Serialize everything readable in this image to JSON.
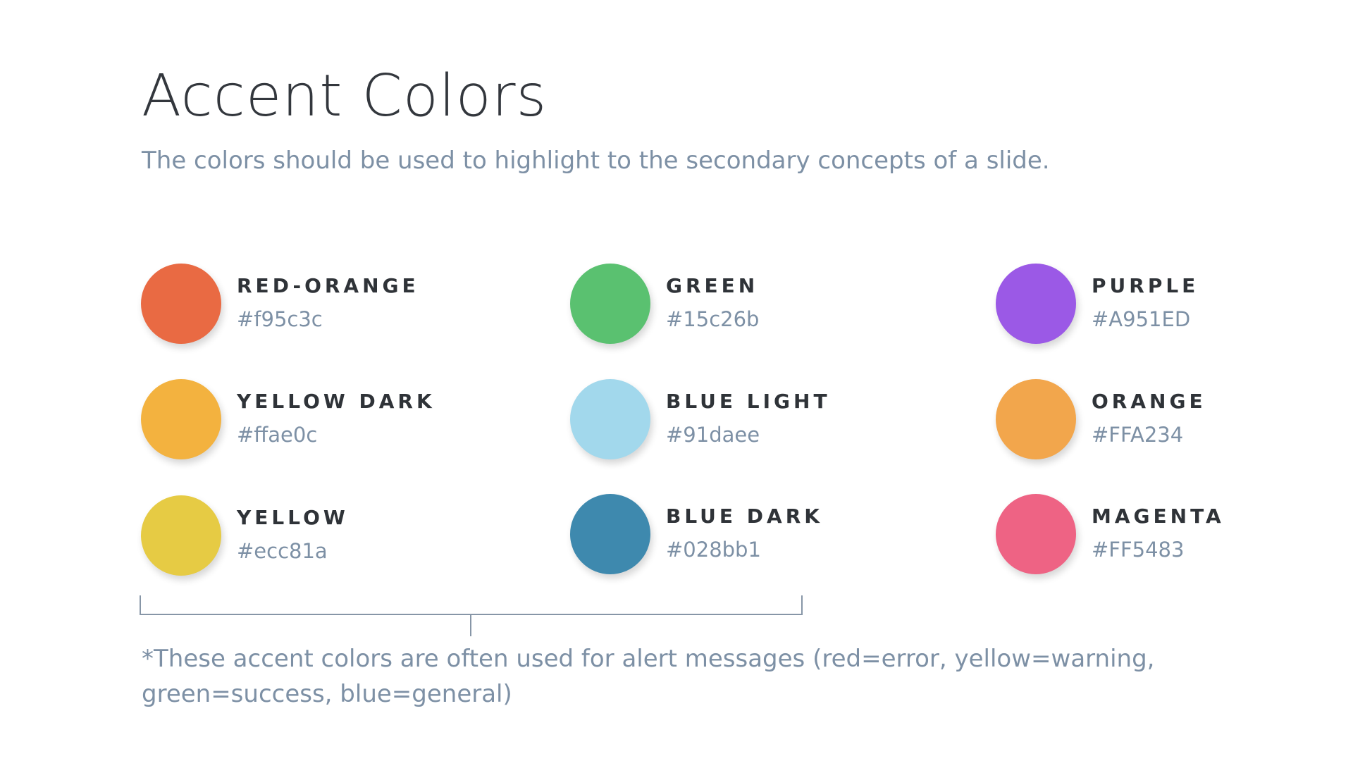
{
  "slide": {
    "title": "Accent Colors",
    "subtitle": "The colors should be used to highlight to the secondary concepts of a slide.",
    "footnote": "*These accent colors are often used for alert messages (red=error, yellow=warning, green=success, blue=general)"
  },
  "swatches": [
    {
      "name": "RED-ORANGE",
      "hex": "#f95c3c",
      "color": "#e96a43"
    },
    {
      "name": "YELLOW DARK",
      "hex": "#ffae0c",
      "color": "#f3b23f"
    },
    {
      "name": "YELLOW",
      "hex": "#ecc81a",
      "color": "#e6cb44"
    },
    {
      "name": "GREEN",
      "hex": "#15c26b",
      "color": "#5ac170"
    },
    {
      "name": "BLUE LIGHT",
      "hex": "#91daee",
      "color": "#a2d8ec"
    },
    {
      "name": "BLUE DARK",
      "hex": "#028bb1",
      "color": "#3e89ae"
    },
    {
      "name": "PURPLE",
      "hex": "#A951ED",
      "color": "#9b59e6"
    },
    {
      "name": "ORANGE",
      "hex": "#FFA234",
      "color": "#f2a64c"
    },
    {
      "name": "MAGENTA",
      "hex": "#FF5483",
      "color": "#ee6384"
    }
  ],
  "colors": {
    "title": "#33373d",
    "muted_text": "#7d90a5",
    "label_text": "#2f3338",
    "bracket_line": "#8796a7"
  }
}
